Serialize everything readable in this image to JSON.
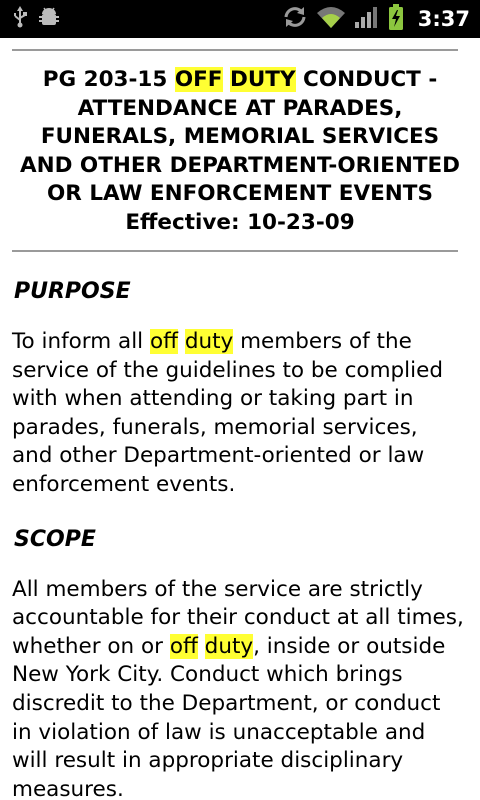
{
  "status_bar": {
    "time": "3:37",
    "icons": [
      "usb-icon",
      "android-debug-icon",
      "sync-icon",
      "wifi-icon",
      "signal-icon",
      "battery-charging-icon"
    ]
  },
  "highlight_color": "#ffff33",
  "document": {
    "title": {
      "code": "PG 203-15",
      "hl_off": "OFF",
      "hl_duty": "DUTY",
      "rest": "CONDUCT - ATTENDANCE AT PARADES, FUNERALS, MEMORIAL SERVICES AND OTHER DEPARTMENT-ORIENTED OR LAW ENFORCEMENT EVENTS",
      "effective": "Effective: 10-23-09"
    },
    "purpose": {
      "heading": "PURPOSE",
      "text_1": "To inform all",
      "hl_off": "off",
      "hl_duty": "duty",
      "text_2": "members of the service of the guidelines to be complied with when attending or taking part in parades, funerals, memorial services, and other Department-oriented or law enforcement events."
    },
    "scope": {
      "heading": "SCOPE",
      "text_1": "All members of the service are strictly accountable for their conduct at all times, whether on or",
      "hl_off": "off",
      "hl_duty": "duty",
      "text_2": ", inside or outside New York City. Conduct which brings discredit to the Department, or conduct in violation of law is unacceptable and will result in appropriate disciplinary measures."
    }
  }
}
